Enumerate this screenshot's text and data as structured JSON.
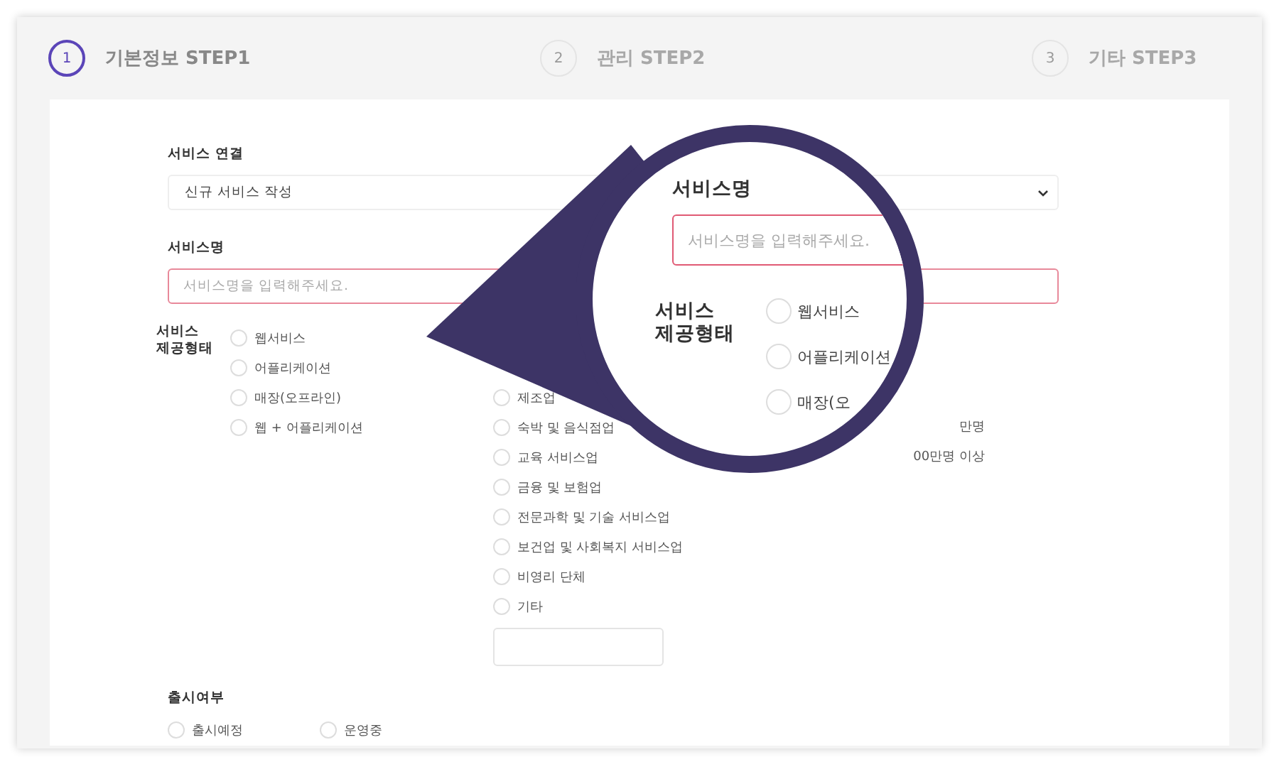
{
  "steps": [
    {
      "number": "1",
      "label": "기본정보 STEP1",
      "selected": true
    },
    {
      "number": "2",
      "label": "관리 STEP2",
      "selected": false
    },
    {
      "number": "3",
      "label": "기타 STEP3",
      "selected": false
    }
  ],
  "service_link": {
    "label": "서비스 연결",
    "value": "신규 서비스 작성"
  },
  "service_name": {
    "label": "서비스명",
    "placeholder": "서비스명을 입력해주세요."
  },
  "service_type": {
    "label_lines": [
      "서비스",
      "제공형태"
    ],
    "options": [
      {
        "label": "웹서비스",
        "selected": false
      },
      {
        "label": "어플리케이션",
        "selected": false
      },
      {
        "label": "매장(오프라인)",
        "selected": false
      },
      {
        "label": "웹 + 어플리케이션",
        "selected": false
      }
    ],
    "industries": [
      {
        "label": "제조업",
        "selected": false
      },
      {
        "label": "숙박 및 음식점업",
        "selected": false
      },
      {
        "label": "교육 서비스업",
        "selected": false
      },
      {
        "label": "금융 및 보험업",
        "selected": false
      },
      {
        "label": "전문과학 및 기술 서비스업",
        "selected": false
      },
      {
        "label": "보건업 및 사회복지 서비스업",
        "selected": false
      },
      {
        "label": "비영리 단체",
        "selected": false
      },
      {
        "label": "기타",
        "selected": false
      }
    ],
    "users": [
      {
        "label": "만명"
      },
      {
        "label": "00만명 이상"
      }
    ]
  },
  "release": {
    "label": "출시여부",
    "options": [
      {
        "label": "출시예정",
        "selected": false
      },
      {
        "label": "운영중",
        "selected": false
      }
    ]
  },
  "magnifier": {
    "name_label": "서비스명",
    "placeholder": "서비스명을 입력해주세요.",
    "type_label_lines": [
      "서비스",
      "제공형태"
    ],
    "options": [
      {
        "label": "웹서비스",
        "selected": false
      },
      {
        "label": "어플리케이션",
        "selected": false
      },
      {
        "label": "매장(오",
        "selected": false
      }
    ]
  }
}
